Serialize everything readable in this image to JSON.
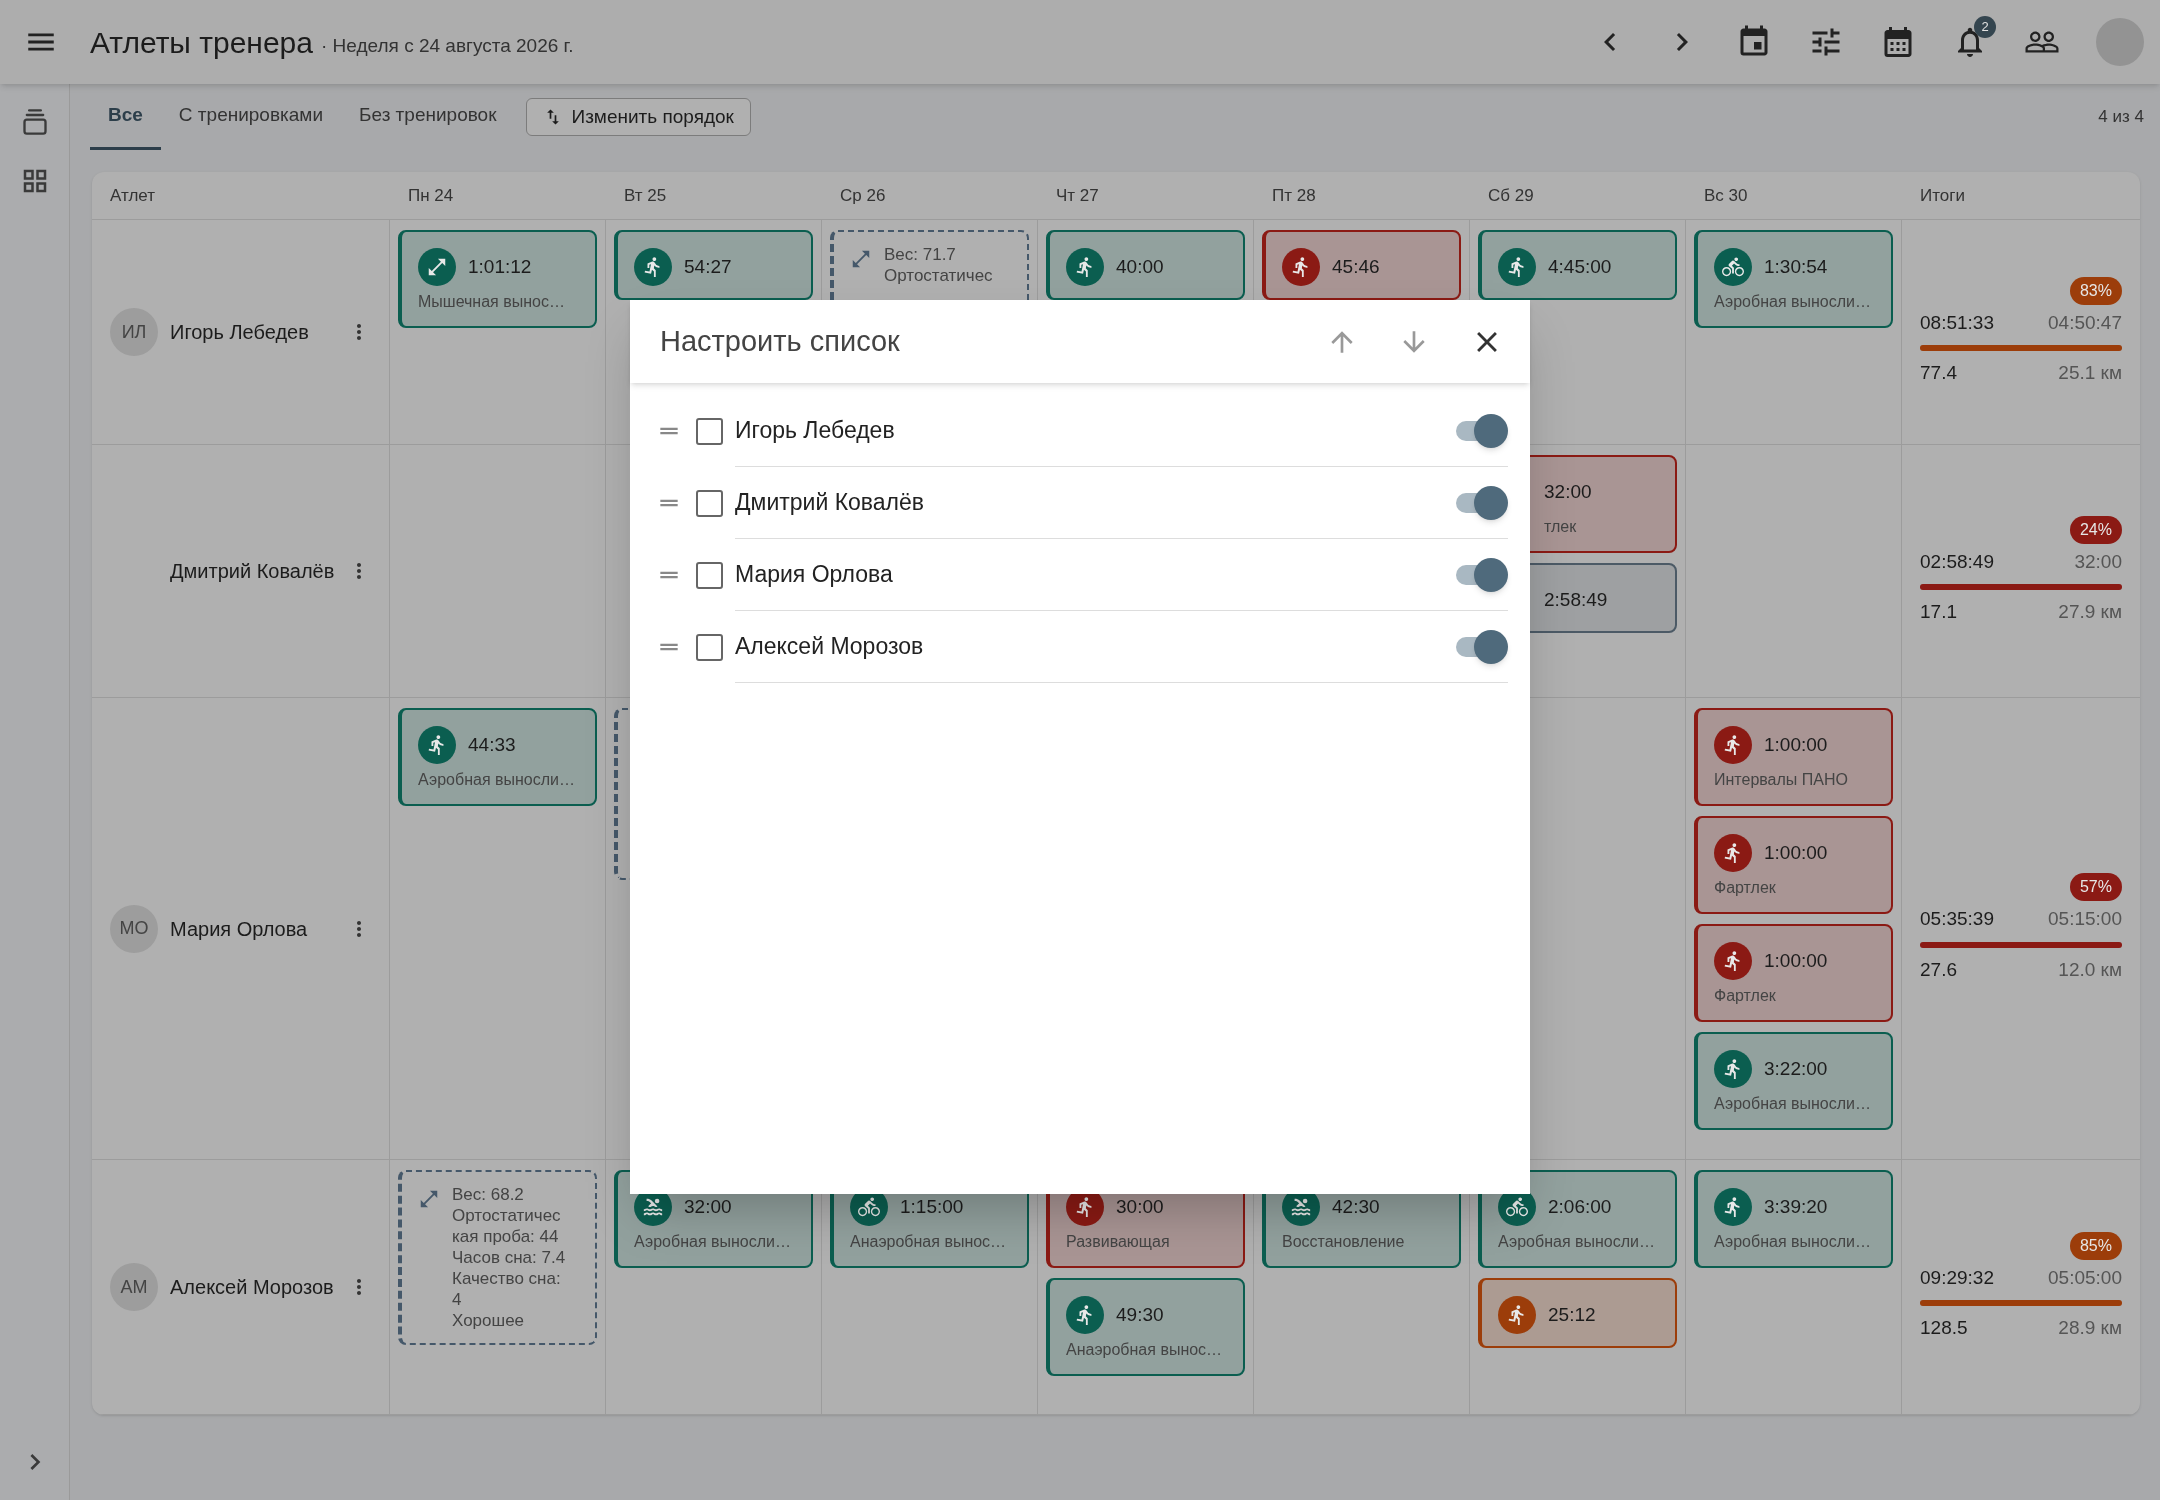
{
  "app_bar": {
    "title": "Атлеты тренера",
    "subtitle": "· Неделя с 24 августа 2026 г.",
    "notification_count": "2"
  },
  "filter_tabs": [
    {
      "label": "Все",
      "selected": true
    },
    {
      "label": "С тренировками",
      "selected": false
    },
    {
      "label": "Без тренировок",
      "selected": false
    }
  ],
  "reorder_button": "Изменить порядок",
  "count": "4 из 4",
  "table": {
    "columns": [
      "Атлет",
      "Пн 24",
      "Вт 25",
      "Ср 26",
      "Чт 27",
      "Пт 28",
      "Сб 29",
      "Вс 30",
      "Итоги"
    ],
    "rows": [
      {
        "initials": "ИЛ",
        "name": "Игорь Лебедев",
        "days": {
          "mon": [
            {
              "kind": "strength",
              "color": "#0b5e50",
              "time": "1:01:12",
              "label": "Мышечная вынос…"
            }
          ],
          "tue": [
            {
              "kind": "run",
              "color": "#0b5e50",
              "time": "54:27"
            }
          ],
          "wed": [
            {
              "kind": "metrics",
              "lines": [
                "Вес: 71.7",
                "Ортостатичес"
              ]
            }
          ],
          "thu": [
            {
              "kind": "run",
              "color": "#0b5e50",
              "time": "40:00"
            }
          ],
          "fri": [
            {
              "kind": "run",
              "color": "#8b1a14",
              "time": "45:46"
            }
          ],
          "sat": [
            {
              "kind": "run",
              "color": "#0b5e50",
              "time": "4:45:00"
            }
          ],
          "sun": [
            {
              "kind": "bike",
              "color": "#0b5e50",
              "time": "1:30:54",
              "label": "Аэробная выносли…"
            }
          ]
        },
        "totals": {
          "badge": "83%",
          "color": "#9c3d0a",
          "time": "08:51:33",
          "planned": "04:50:47",
          "level": 1,
          "load": "77.4",
          "distance": "25.1 км"
        }
      },
      {
        "name": "Дмитрий Ковалёв",
        "days": {
          "sat": [
            {
              "kind": "partial",
              "color": "#8b1a14",
              "time": "32:00",
              "label": "тлек"
            },
            {
              "kind": "partial",
              "color": "#4c5a66",
              "time": "2:58:49"
            }
          ]
        },
        "totals": {
          "badge": "24%",
          "color": "#8b1a14",
          "time": "02:58:49",
          "planned": "32:00",
          "level": 1,
          "load": "17.1",
          "distance": "27.9 км"
        }
      },
      {
        "initials": "МО",
        "name": "Мария Орлова",
        "days": {
          "mon": [
            {
              "kind": "run",
              "color": "#0b5e50",
              "time": "44:33",
              "label": "Аэробная выносли…"
            }
          ],
          "tue": [
            {
              "kind": "metrics"
            }
          ],
          "sun": [
            {
              "kind": "run",
              "color": "#8b1a14",
              "time": "1:00:00",
              "label": "Интервалы ПАНО"
            },
            {
              "kind": "run",
              "color": "#8b1a14",
              "time": "1:00:00",
              "label": "Фартлек"
            },
            {
              "kind": "run",
              "color": "#8b1a14",
              "time": "1:00:00",
              "label": "Фартлек"
            },
            {
              "kind": "run",
              "color": "#0b5e50",
              "time": "3:22:00",
              "label": "Аэробная выносли…"
            }
          ]
        },
        "totals": {
          "badge": "57%",
          "color": "#8b1a14",
          "time": "05:35:39",
          "planned": "05:15:00",
          "level": 1,
          "load": "27.6",
          "distance": "12.0 км"
        }
      },
      {
        "initials": "АМ",
        "name": "Алексей Морозов",
        "days": {
          "mon": [
            {
              "kind": "metrics",
              "lines": [
                "Вес: 68.2",
                "Ортостатичес",
                "кая проба: 44",
                "Часов сна: 7.4",
                "Качество сна:",
                "4",
                "Хорошее"
              ]
            }
          ],
          "tue": [
            {
              "kind": "swim",
              "color": "#0b5e50",
              "time": "32:00",
              "label": "Аэробная выносли…"
            }
          ],
          "wed": [
            {
              "kind": "bike",
              "color": "#0b5e50",
              "time": "1:15:00",
              "label": "Анаэробная вынос…"
            }
          ],
          "thu": [
            {
              "kind": "run",
              "color": "#8b1a14",
              "time": "30:00",
              "label": "Развивающая"
            },
            {
              "kind": "run",
              "color": "#0b5e50",
              "time": "49:30",
              "label": "Анаэробная вынос…"
            }
          ],
          "fri": [
            {
              "kind": "swim",
              "color": "#0b5e50",
              "time": "42:30",
              "label": "Восстановление"
            }
          ],
          "sat": [
            {
              "kind": "bike",
              "color": "#0b5e50",
              "time": "2:06:00",
              "label": "Аэробная выносли…"
            },
            {
              "kind": "run",
              "color": "#9c3d0a",
              "time": "25:12"
            }
          ],
          "sun": [
            {
              "kind": "run",
              "color": "#0b5e50",
              "time": "3:39:20",
              "label": "Аэробная выносли…"
            }
          ]
        },
        "totals": {
          "badge": "85%",
          "color": "#9c3d0a",
          "time": "09:29:32",
          "planned": "05:05:00",
          "level": 1,
          "load": "128.5",
          "distance": "28.9 км"
        }
      }
    ]
  },
  "dialog": {
    "title": "Настроить список",
    "items": [
      {
        "name": "Игорь Лебедев",
        "checked": false,
        "on": true
      },
      {
        "name": "Дмитрий Ковалёв",
        "checked": false,
        "on": true
      },
      {
        "name": "Мария Орлова",
        "checked": false,
        "on": true
      },
      {
        "name": "Алексей Морозов",
        "checked": false,
        "on": true
      }
    ]
  }
}
